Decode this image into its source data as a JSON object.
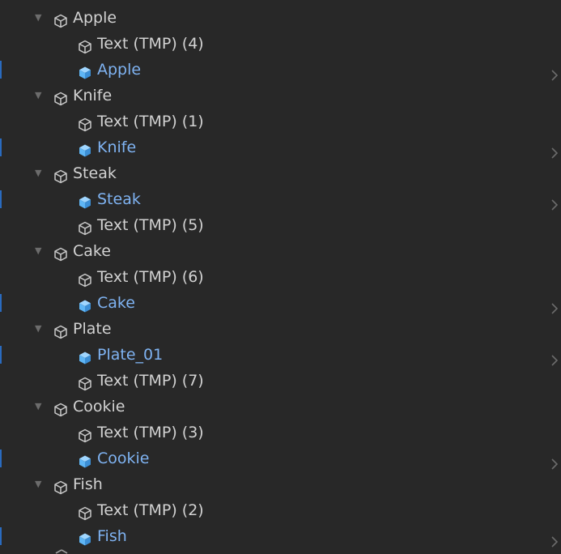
{
  "hierarchy": {
    "groups": [
      {
        "name": "Apple",
        "children": [
          {
            "label": "Text (TMP) (4)",
            "prefab": false
          },
          {
            "label": "Apple",
            "prefab": true
          }
        ]
      },
      {
        "name": "Knife",
        "children": [
          {
            "label": "Text (TMP) (1)",
            "prefab": false
          },
          {
            "label": "Knife",
            "prefab": true
          }
        ]
      },
      {
        "name": "Steak",
        "children": [
          {
            "label": "Steak",
            "prefab": true
          },
          {
            "label": "Text (TMP) (5)",
            "prefab": false
          }
        ]
      },
      {
        "name": "Cake",
        "children": [
          {
            "label": "Text (TMP) (6)",
            "prefab": false
          },
          {
            "label": "Cake",
            "prefab": true
          }
        ]
      },
      {
        "name": "Plate",
        "children": [
          {
            "label": "Plate_01",
            "prefab": true
          },
          {
            "label": "Text (TMP) (7)",
            "prefab": false
          }
        ]
      },
      {
        "name": "Cookie",
        "children": [
          {
            "label": "Text (TMP) (3)",
            "prefab": false
          },
          {
            "label": "Cookie",
            "prefab": true
          }
        ]
      },
      {
        "name": "Fish",
        "children": [
          {
            "label": "Text (TMP) (2)",
            "prefab": false
          },
          {
            "label": "Fish",
            "prefab": true
          }
        ]
      }
    ]
  },
  "colors": {
    "background": "#282828",
    "text": "#d2d2d2",
    "prefab_text": "#7fb3f2",
    "prefab_icon": "#5fb6f5",
    "gameobject_icon": "#c8c8c8",
    "chevron": "#6c6c6c",
    "selection_marker": "#2a6bbf"
  },
  "icons": {
    "expand": "triangle-down-icon",
    "gameobject": "cube-outline-icon",
    "prefab": "prefab-cube-icon",
    "open_prefab": "chevron-right-icon"
  }
}
